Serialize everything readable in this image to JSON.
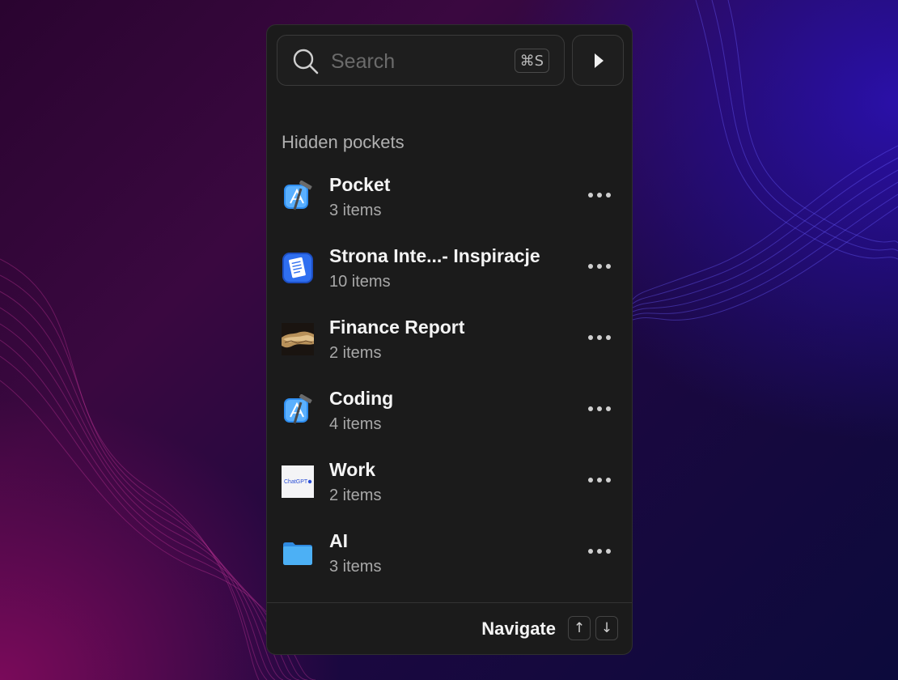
{
  "search": {
    "placeholder": "Search",
    "shortcut": "⌘S"
  },
  "section_title": "Hidden pockets",
  "pockets": [
    {
      "name": "Pocket",
      "count": "3 items",
      "icon": "xcode-icon"
    },
    {
      "name": "Strona Inte...- Inspiracje",
      "count": "10 items",
      "icon": "document-app-icon"
    },
    {
      "name": "Finance Report",
      "count": "2 items",
      "icon": "photo-thumbnail"
    },
    {
      "name": "Coding",
      "count": "4 items",
      "icon": "xcode-icon"
    },
    {
      "name": "Work",
      "count": "2 items",
      "icon": "chatgpt-thumbnail",
      "thumb_text": "ChatGPT"
    },
    {
      "name": "AI",
      "count": "3 items",
      "icon": "folder-icon"
    }
  ],
  "footer": {
    "label": "Navigate",
    "up_key": "↑",
    "down_key": "↓"
  },
  "colors": {
    "panel_bg": "#1b1b1b",
    "accent_blue": "#2f8ef0",
    "folder_blue": "#3aa0f0"
  }
}
